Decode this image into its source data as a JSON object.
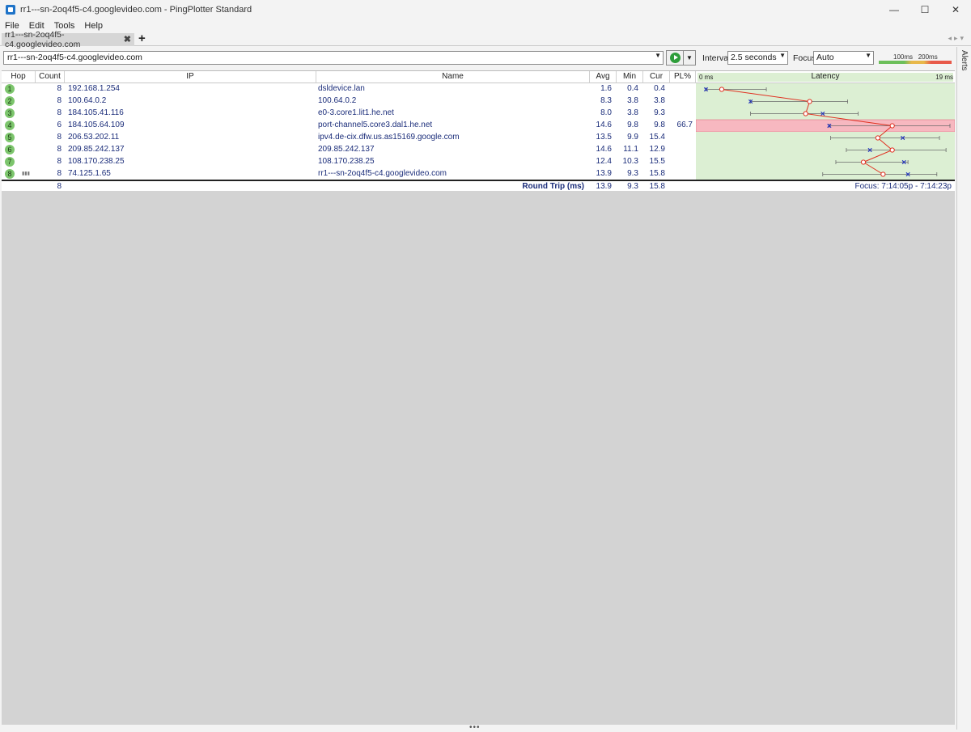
{
  "window": {
    "title": "rr1---sn-2oq4f5-c4.googlevideo.com - PingPlotter Standard",
    "minimize": "—",
    "maximize": "☐",
    "close": "✕"
  },
  "menu": [
    "File",
    "Edit",
    "Tools",
    "Help"
  ],
  "tabs": [
    {
      "label": "rr1---sn-2oq4f5-c4.googlevideo.com"
    }
  ],
  "tab_add": "+",
  "toolbar": {
    "target": "rr1---sn-2oq4f5-c4.googlevideo.com",
    "interval_label": "Interval",
    "interval_value": "2.5 seconds",
    "focus_label": "Focus",
    "focus_value": "Auto",
    "legend_100": "100ms",
    "legend_200": "200ms"
  },
  "alerts_label": "Alerts",
  "columns": {
    "hop": "Hop",
    "count": "Count",
    "ip": "IP",
    "name": "Name",
    "avg": "Avg",
    "min": "Min",
    "cur": "Cur",
    "pl": "PL%",
    "latency": "Latency"
  },
  "graph_scale": {
    "min_label": "0 ms",
    "max_label": "19 ms",
    "max_ms": 19
  },
  "hops": [
    {
      "hop": "1",
      "count": "8",
      "ip": "192.168.1.254",
      "name": "dsldevice.lan",
      "avg": "1.6",
      "min": "0.4",
      "cur": "0.4",
      "pl": "",
      "max_ms": 5.0
    },
    {
      "hop": "2",
      "count": "8",
      "ip": "100.64.0.2",
      "name": "100.64.0.2",
      "avg": "8.3",
      "min": "3.8",
      "cur": "3.8",
      "pl": "",
      "max_ms": 11.2
    },
    {
      "hop": "3",
      "count": "8",
      "ip": "184.105.41.116",
      "name": "e0-3.core1.lit1.he.net",
      "avg": "8.0",
      "min": "3.8",
      "cur": "9.3",
      "pl": "",
      "max_ms": 12.0
    },
    {
      "hop": "4",
      "count": "6",
      "ip": "184.105.64.109",
      "name": "port-channel5.core3.dal1.he.net",
      "avg": "14.6",
      "min": "9.8",
      "cur": "9.8",
      "pl": "66.7",
      "max_ms": 19.0
    },
    {
      "hop": "5",
      "count": "8",
      "ip": "206.53.202.11",
      "name": "ipv4.de-cix.dfw.us.as15169.google.com",
      "avg": "13.5",
      "min": "9.9",
      "cur": "15.4",
      "pl": "",
      "max_ms": 18.2
    },
    {
      "hop": "6",
      "count": "8",
      "ip": "209.85.242.137",
      "name": "209.85.242.137",
      "avg": "14.6",
      "min": "11.1",
      "cur": "12.9",
      "pl": "",
      "max_ms": 18.7
    },
    {
      "hop": "7",
      "count": "8",
      "ip": "108.170.238.25",
      "name": "108.170.238.25",
      "avg": "12.4",
      "min": "10.3",
      "cur": "15.5",
      "pl": "",
      "max_ms": 15.8
    },
    {
      "hop": "8",
      "count": "8",
      "ip": "74.125.1.65",
      "name": "rr1---sn-2oq4f5-c4.googlevideo.com",
      "avg": "13.9",
      "min": "9.3",
      "cur": "15.8",
      "pl": "",
      "max_ms": 18.0
    }
  ],
  "summary": {
    "count": "8",
    "label": "Round Trip (ms)",
    "avg": "13.9",
    "min": "9.3",
    "cur": "15.8",
    "focus": "Focus: 7:14:05p - 7:14:23p"
  },
  "colors": {
    "hop_green": "#7cc56c",
    "graph_green": "#dcefd3",
    "loss_red": "#f7b8c0",
    "line_red": "#e03020",
    "cur_blue": "#2233bb"
  }
}
